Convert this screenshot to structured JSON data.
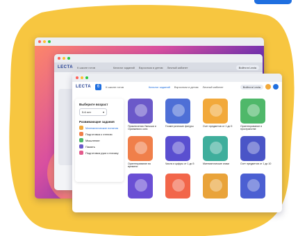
{
  "accent": "#1f6fe0",
  "front": {
    "logo": "LECTA",
    "logo_badge": "6",
    "school_label": "К школе готов",
    "nav": [
      "Каталог заданий",
      "Взрослым и детям",
      "Личный кабинет"
    ],
    "auth_label": "Войти в Lecta",
    "sidebar": {
      "age_title": "Выберите возраст",
      "age_value": "5-6 лет",
      "skills_title": "Развивающие задания",
      "items": [
        "Математические понятия",
        "Подготовка к чтению",
        "Мышление",
        "Память",
        "Подготовка руки к письму"
      ]
    },
    "cards": [
      {
        "label": "Приключения Умныши и Оранжевого кота",
        "color": "#6b59c9"
      },
      {
        "label": "Геометрические фигуры",
        "color": "#4e6fd6"
      },
      {
        "label": "Счет предметов от 1 до 5",
        "color": "#f2a93b"
      },
      {
        "label": "Ориентирование в пространстве",
        "color": "#4fb86a"
      },
      {
        "label": "Ориентирование во времени",
        "color": "#f07f4a"
      },
      {
        "label": "Числа и цифры от 1 до 5",
        "color": "#5a4fd0"
      },
      {
        "label": "Математические знаки",
        "color": "#3fae9c"
      },
      {
        "label": "Счет предметов от 1 до 10",
        "color": "#4a55c7"
      },
      {
        "label": "",
        "color": "#6a4fd4"
      },
      {
        "label": "",
        "color": "#f2664a"
      },
      {
        "label": "",
        "color": "#e9a33a"
      },
      {
        "label": "",
        "color": "#4b5fd2"
      }
    ]
  },
  "middle": {
    "logo": "LECTA",
    "school_label": "К школе готов",
    "nav": [
      "Каталог заданий",
      "Взрослым и детям",
      "Личный кабинет"
    ],
    "auth_label": "Войти в Lecta"
  }
}
